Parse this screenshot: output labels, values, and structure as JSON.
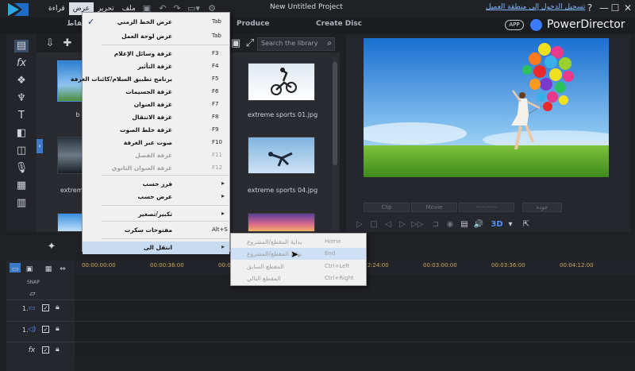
{
  "window": {
    "title": "New Untitled Project",
    "signin": "تسجيل الدخول إلى منطقة العميل",
    "help": "?",
    "minimize": "—",
    "maximize": "☐",
    "close": "✕"
  },
  "menubar": {
    "items": [
      "ملف",
      "تحرير",
      "عرض",
      "قراءة"
    ]
  },
  "modes": {
    "capture_partial": "لقاط",
    "produce": "Produce",
    "create_disc": "Create Disc"
  },
  "brand": {
    "app_label": "APP",
    "name": "PowerDirector"
  },
  "library": {
    "search_placeholder": "Search the library",
    "items": [
      {
        "label": "b",
        "scene": "blue"
      },
      {
        "label": "extreme sports 01.jpg",
        "scene": "bmx"
      },
      {
        "label": "extreme",
        "scene": "dark"
      },
      {
        "label": "extreme sports 04.jpg",
        "scene": "skydive"
      },
      {
        "label": "",
        "scene": "sky"
      },
      {
        "label": "",
        "scene": "sunset"
      }
    ]
  },
  "view_menu": {
    "items": [
      {
        "label": "عرض الخط الزمني",
        "key": "Tab",
        "checked": true,
        "disabled": false,
        "submenu": false
      },
      {
        "label": "عرض لوحة العمل",
        "key": "Tab",
        "checked": false,
        "disabled": false,
        "submenu": false
      },
      {
        "label": "غرفة وسائل الإعلام",
        "key": "F3",
        "checked": false,
        "disabled": false,
        "submenu": false
      },
      {
        "label": "غرفة التأثير",
        "key": "F4",
        "checked": false,
        "disabled": false,
        "submenu": false
      },
      {
        "label": "برنامج تطبيق السلام/كائنات الغرفة",
        "key": "F5",
        "checked": false,
        "disabled": false,
        "submenu": false
      },
      {
        "label": "غرفة الجسيمات",
        "key": "F6",
        "checked": false,
        "disabled": false,
        "submenu": false
      },
      {
        "label": "غرفة العنوان",
        "key": "F7",
        "checked": false,
        "disabled": false,
        "submenu": false
      },
      {
        "label": "غرفة الانتقال",
        "key": "F8",
        "checked": false,
        "disabled": false,
        "submenu": false
      },
      {
        "label": "غرفة خلط الصوت",
        "key": "F9",
        "checked": false,
        "disabled": false,
        "submenu": false
      },
      {
        "label": "صوت عبر الغرفة",
        "key": "F10",
        "checked": false,
        "disabled": false,
        "submenu": false
      },
      {
        "label": "غرفة الفصل",
        "key": "F11",
        "checked": false,
        "disabled": true,
        "submenu": false
      },
      {
        "label": "غرفة العنوان الثانوي",
        "key": "F12",
        "checked": false,
        "disabled": true,
        "submenu": false
      },
      {
        "label": "فرز حسب",
        "key": "",
        "checked": false,
        "disabled": false,
        "submenu": true
      },
      {
        "label": "عرض حسب",
        "key": "",
        "checked": false,
        "disabled": false,
        "submenu": true
      },
      {
        "label": "تكبير/تصغير",
        "key": "",
        "checked": false,
        "disabled": false,
        "submenu": true
      },
      {
        "label": "مفتوحات سكرت",
        "key": "Alt+S",
        "checked": false,
        "disabled": false,
        "submenu": false
      },
      {
        "label": "انتقل الى",
        "key": "",
        "checked": false,
        "disabled": false,
        "submenu": true,
        "hot": true
      }
    ]
  },
  "goto_submenu": {
    "items": [
      {
        "label": "بداية المقطع/المشروع",
        "key": "Home"
      },
      {
        "label": "نهاية المقطع/المشروع",
        "key": "End"
      },
      {
        "label": "المقطع السابق",
        "key": "Ctrl+Left"
      },
      {
        "label": "المقطع التالي",
        "key": "Ctrl+Right"
      }
    ]
  },
  "preview": {
    "clip_label": "Clip",
    "movie_label": "Movie",
    "timecode": "--:--:--:--",
    "quality": "جودة",
    "mode_3d": "3D"
  },
  "timeline": {
    "ticks": [
      "00:00:00:00",
      "00:00:36:00",
      "00:01:12:00",
      "00:01:48:00",
      "00:02:24:00",
      "00:03:00:00",
      "00:03:36:00",
      "00:04:12:00"
    ],
    "snap_label": "SNAP",
    "tracks": [
      {
        "num": "1.",
        "kind": "video"
      },
      {
        "num": "1.",
        "kind": "audio"
      },
      {
        "num": "",
        "kind": "fx"
      }
    ]
  },
  "colors": {
    "accent": "#3a7bff",
    "menu_bg": "#f0f0f0",
    "menu_hot": "#c7dbf0",
    "timecode": "#c9a85c"
  }
}
